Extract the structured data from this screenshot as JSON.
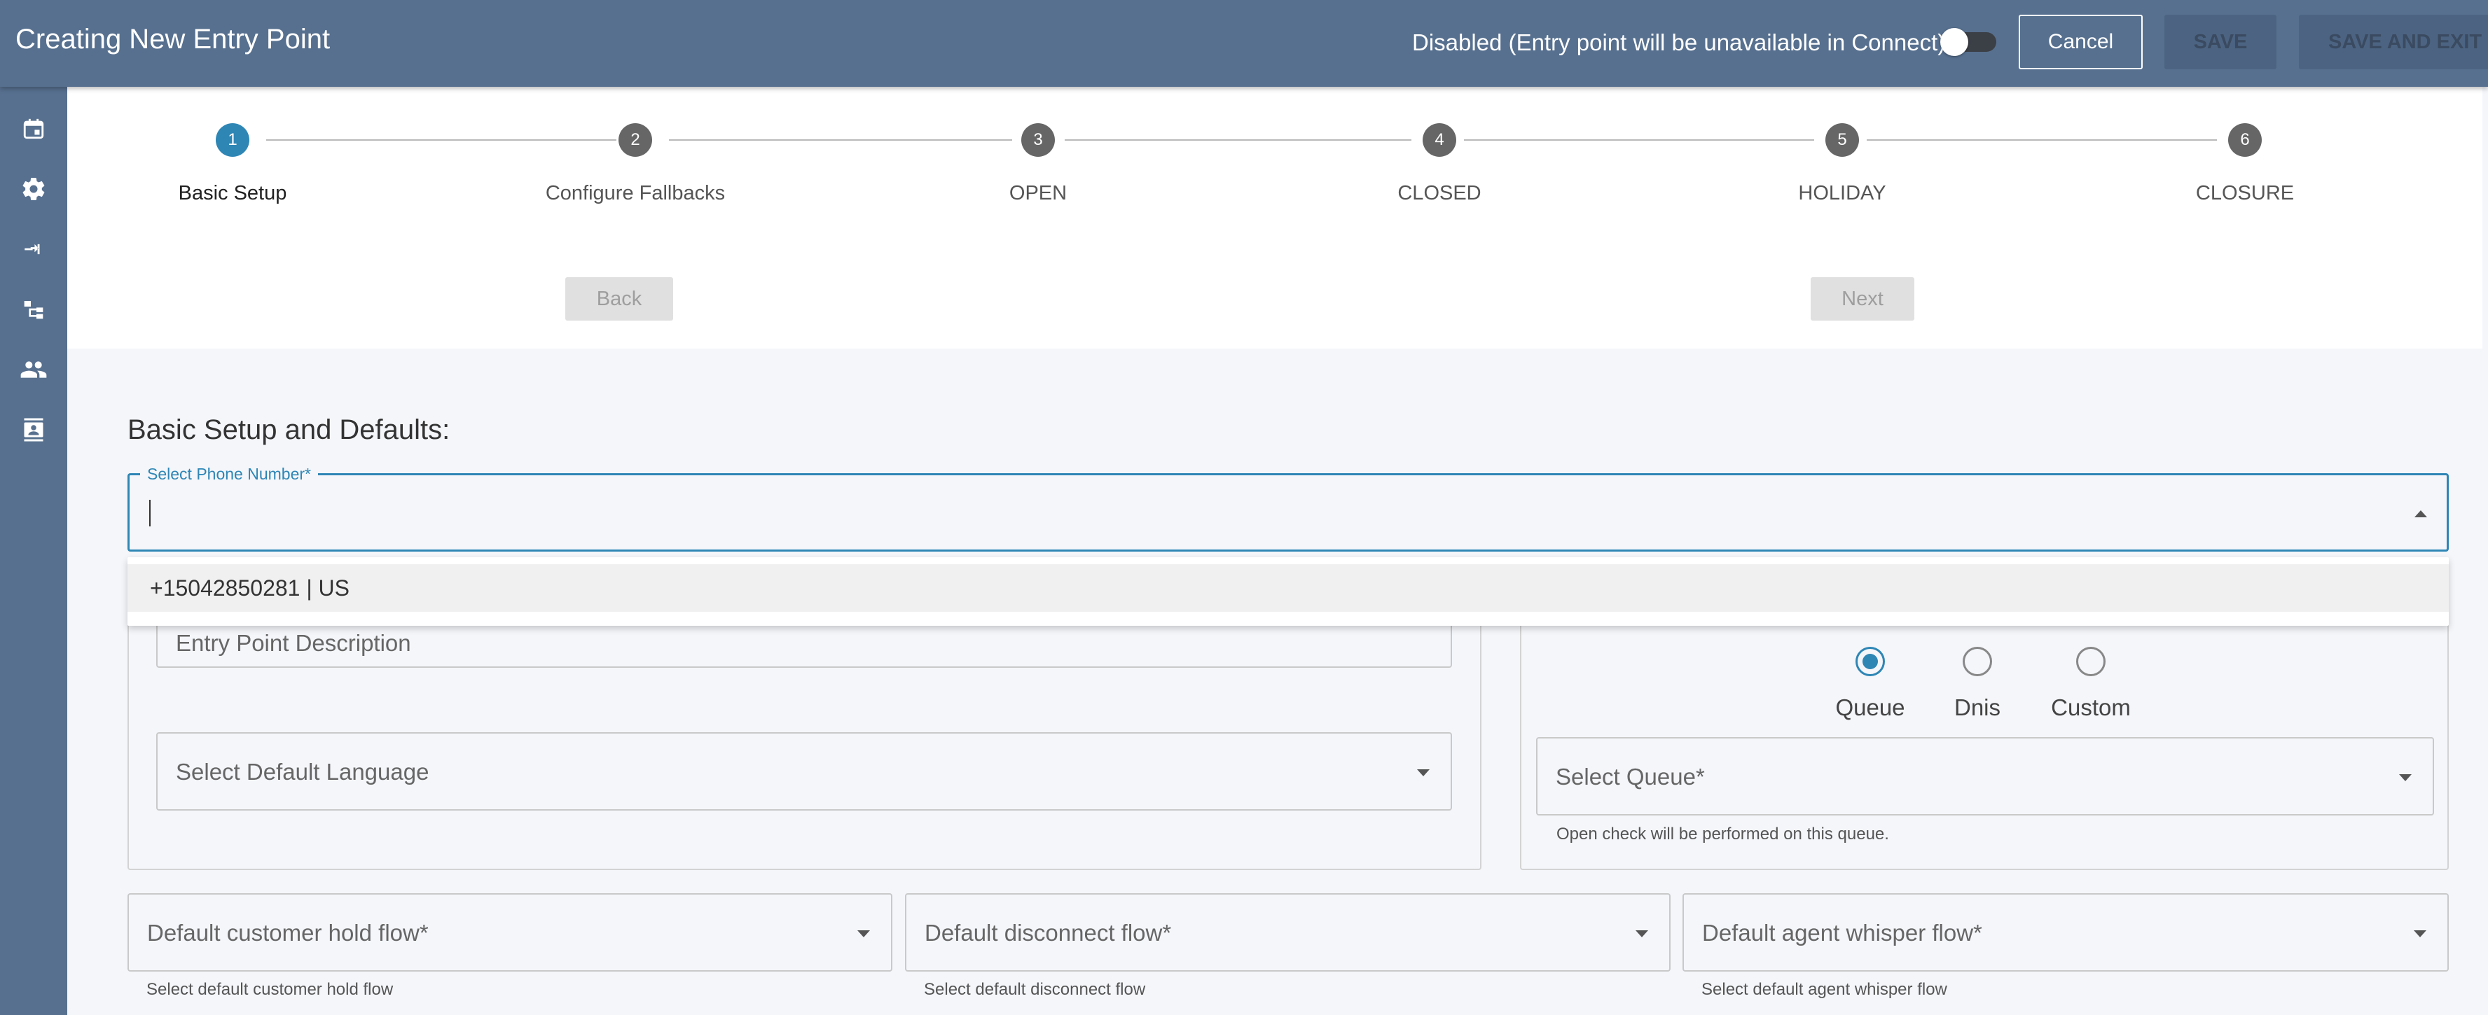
{
  "header": {
    "title": "Creating New Entry Point",
    "status_text": "Disabled (Entry point will be unavailable in Connect)",
    "toggle_enabled": false,
    "cancel_label": "Cancel",
    "save_label": "SAVE",
    "save_exit_label": "SAVE AND EXIT"
  },
  "sidebar": {
    "items": [
      {
        "icon": "calendar-icon"
      },
      {
        "icon": "gear-icon"
      },
      {
        "icon": "transfer-arrows-icon"
      },
      {
        "icon": "flow-tree-icon"
      },
      {
        "icon": "people-icon"
      },
      {
        "icon": "contact-card-icon"
      }
    ]
  },
  "stepper": {
    "active_step": 1,
    "steps": [
      {
        "number": "1",
        "label": "Basic Setup"
      },
      {
        "number": "2",
        "label": "Configure Fallbacks"
      },
      {
        "number": "3",
        "label": "OPEN"
      },
      {
        "number": "4",
        "label": "CLOSED"
      },
      {
        "number": "5",
        "label": "HOLIDAY"
      },
      {
        "number": "6",
        "label": "CLOSURE"
      }
    ],
    "back_label": "Back",
    "next_label": "Next"
  },
  "form": {
    "section_title": "Basic Setup and Defaults:",
    "phone_number": {
      "label": "Select Phone Number*",
      "value": "",
      "options": [
        "+15042850281 | US"
      ]
    },
    "description_placeholder": "Entry Point Description",
    "language_placeholder": "Select Default Language",
    "open_check_type": {
      "options": [
        "Queue",
        "Dnis",
        "Custom"
      ],
      "selected": "Queue"
    },
    "queue": {
      "placeholder": "Select Queue*",
      "helper": "Open check will be performed on this queue."
    },
    "hold_flow": {
      "placeholder": "Default customer hold flow*",
      "helper": "Select default customer hold flow"
    },
    "disconnect_flow": {
      "placeholder": "Default disconnect flow*",
      "helper": "Select default disconnect flow"
    },
    "whisper_flow": {
      "placeholder": "Default agent whisper flow*",
      "helper": "Select default agent whisper flow"
    }
  },
  "colors": {
    "header_bg": "#57708f",
    "accent": "#2e86b5",
    "page_bg": "#f4f6fa"
  }
}
